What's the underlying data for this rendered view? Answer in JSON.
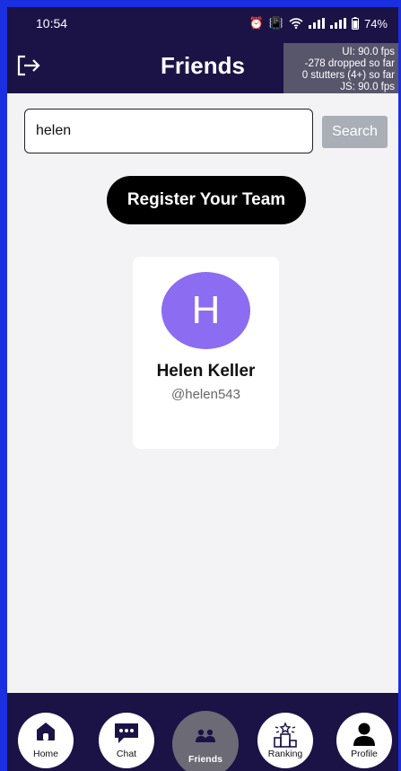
{
  "status_bar": {
    "time": "10:54",
    "battery": "74%"
  },
  "header": {
    "title": "Friends",
    "perf_overlay": [
      "UI: 90.0 fps",
      "-278 dropped so far",
      "0 stutters (4+) so far",
      "JS: 90.0 fps"
    ]
  },
  "search": {
    "value": "helen",
    "button_label": "Search"
  },
  "register_button": "Register Your Team",
  "friend_result": {
    "initial": "H",
    "name": "Helen Keller",
    "handle": "@helen543",
    "avatar_color": "#8c6cf0"
  },
  "tabs": [
    {
      "label": "Home",
      "icon": "home-icon"
    },
    {
      "label": "Chat",
      "icon": "chat-icon"
    },
    {
      "label": "Friends",
      "icon": "friends-icon",
      "active": true
    },
    {
      "label": "Ranking",
      "icon": "ranking-icon"
    },
    {
      "label": "Profile",
      "icon": "profile-icon"
    }
  ],
  "colors": {
    "header_bg": "#1b1346",
    "frame": "#1a2fe0",
    "content_bg": "#f3f3f5",
    "active_tab": "#6b6a75"
  }
}
